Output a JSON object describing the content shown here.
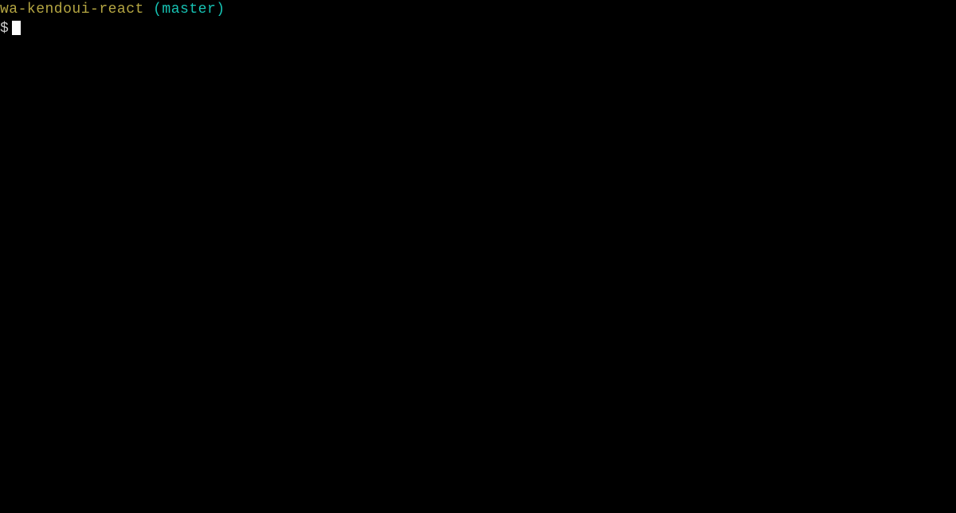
{
  "terminal": {
    "line1": {
      "path": "wa-kendoui-react",
      "branch": " (master)"
    },
    "line2": {
      "prompt": "$"
    }
  }
}
